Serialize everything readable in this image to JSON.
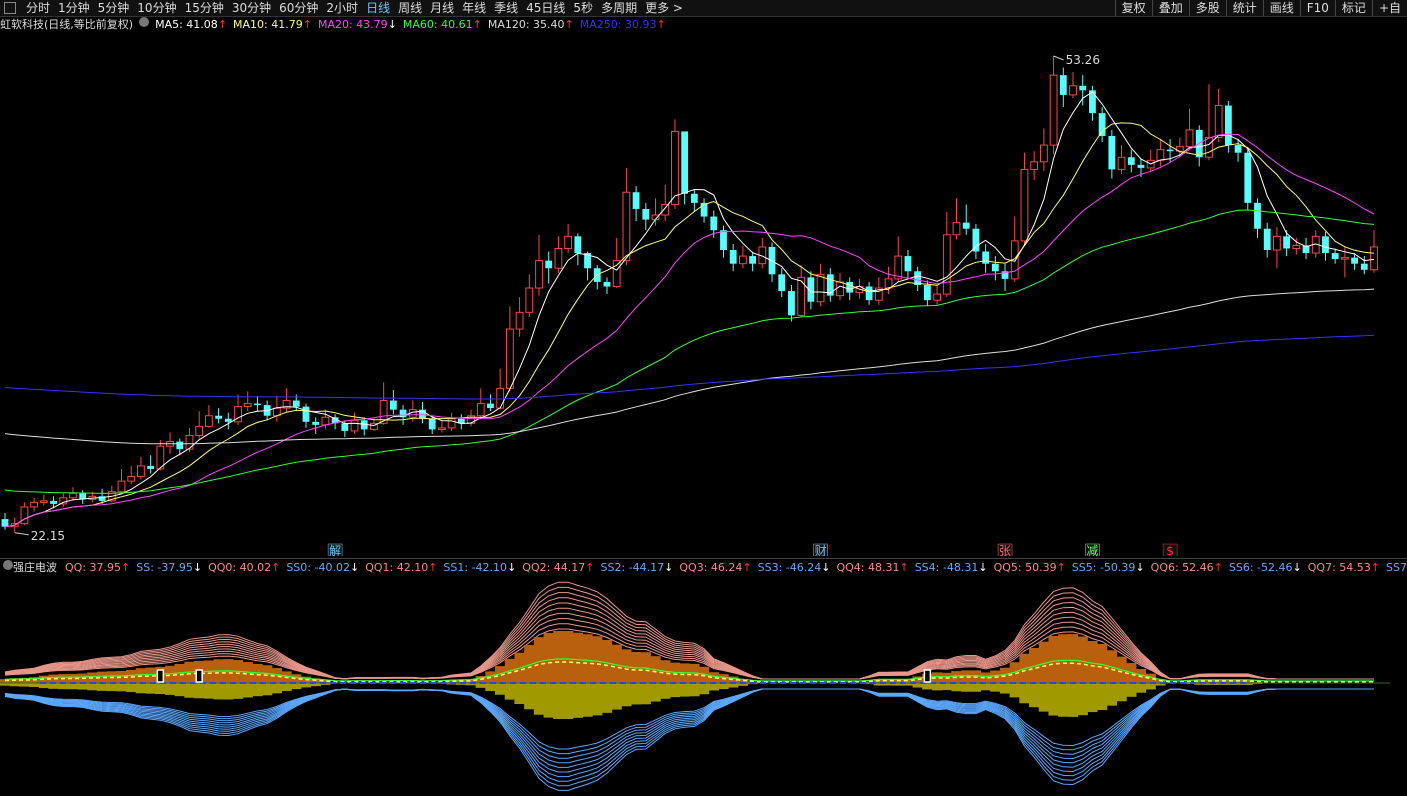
{
  "toolbar": {
    "tabs": [
      "分时",
      "1分钟",
      "5分钟",
      "10分钟",
      "15分钟",
      "30分钟",
      "60分钟",
      "2小时",
      "日线",
      "周线",
      "月线",
      "年线",
      "季线",
      "45日线",
      "5秒",
      "多周期",
      "更多 >"
    ],
    "active_tab": "日线",
    "right_buttons": [
      "复权",
      "叠加",
      "多股",
      "统计",
      "画线",
      "F10",
      "标记",
      "+自"
    ]
  },
  "ma_legend": {
    "stock_name": "虹软科技(日线,等比前复权)",
    "items": [
      {
        "label": "MA5: 41.08",
        "arrow": "↑",
        "color": "#ffffff"
      },
      {
        "label": "MA10: 41.79",
        "arrow": "↑",
        "color": "#ffff66"
      },
      {
        "label": "MA20: 43.79",
        "arrow": "↓",
        "color": "#ff44ff"
      },
      {
        "label": "MA60: 40.61",
        "arrow": "↑",
        "color": "#33ff33"
      },
      {
        "label": "MA120: 35.40",
        "arrow": "↑",
        "color": "#dddddd"
      },
      {
        "label": "MA250: 30.93",
        "arrow": "↑",
        "color": "#3333ff"
      }
    ]
  },
  "indicator_legend": {
    "name": "强庄电波",
    "items": [
      {
        "label": "QQ: 37.95",
        "arrow": "↑",
        "color": "#ff8888"
      },
      {
        "label": "SS: -37.95",
        "arrow": "↓",
        "color": "#66aaff"
      },
      {
        "label": "QQ0: 40.02",
        "arrow": "↑",
        "color": "#ff8888"
      },
      {
        "label": "SS0: -40.02",
        "arrow": "↓",
        "color": "#66aaff"
      },
      {
        "label": "QQ1: 42.10",
        "arrow": "↑",
        "color": "#ff8888"
      },
      {
        "label": "SS1: -42.10",
        "arrow": "↓",
        "color": "#66aaff"
      },
      {
        "label": "QQ2: 44.17",
        "arrow": "↑",
        "color": "#ff8888"
      },
      {
        "label": "SS2: -44.17",
        "arrow": "↓",
        "color": "#66aaff"
      },
      {
        "label": "QQ3: 46.24",
        "arrow": "↑",
        "color": "#ff8888"
      },
      {
        "label": "SS3: -46.24",
        "arrow": "↓",
        "color": "#66aaff"
      },
      {
        "label": "QQ4: 48.31",
        "arrow": "↑",
        "color": "#ff8888"
      },
      {
        "label": "SS4: -48.31",
        "arrow": "↓",
        "color": "#66aaff"
      },
      {
        "label": "QQ5: 50.39",
        "arrow": "↑",
        "color": "#ff8888"
      },
      {
        "label": "SS5: -50.39",
        "arrow": "↓",
        "color": "#66aaff"
      },
      {
        "label": "QQ6: 52.46",
        "arrow": "↑",
        "color": "#ff8888"
      },
      {
        "label": "SS6: -52.46",
        "arrow": "↓",
        "color": "#66aaff"
      },
      {
        "label": "QQ7: 54.53",
        "arrow": "↑",
        "color": "#ff8888"
      },
      {
        "label": "SS7",
        "arrow": "",
        "color": "#66aaff"
      }
    ]
  },
  "chart_data": {
    "type": "candlestick",
    "price_range": [
      22.15,
      53.26
    ],
    "high_label": "53.26",
    "low_label": "22.15",
    "event_markers": [
      {
        "text": "解",
        "color": "#66ccff"
      },
      {
        "text": "财",
        "color": "#66ccff"
      },
      {
        "text": "张",
        "color": "#ff6666"
      },
      {
        "text": "减",
        "color": "#66ff66"
      },
      {
        "text": "$",
        "color": "#ff3333"
      }
    ],
    "candles": [
      [
        22.8,
        22.3,
        23.2,
        22.1
      ],
      [
        22.3,
        22.5,
        22.9,
        21.9
      ],
      [
        22.5,
        23.6,
        23.9,
        22.4
      ],
      [
        23.6,
        23.9,
        24.2,
        23.3
      ],
      [
        23.9,
        24.0,
        24.4,
        23.7
      ],
      [
        24.0,
        23.8,
        24.3,
        23.5
      ],
      [
        23.8,
        24.2,
        24.5,
        23.6
      ],
      [
        24.2,
        24.5,
        24.9,
        24.0
      ],
      [
        24.5,
        24.1,
        24.7,
        23.8
      ],
      [
        24.1,
        24.3,
        24.6,
        23.9
      ],
      [
        24.3,
        24.0,
        24.8,
        23.8
      ],
      [
        24.0,
        24.6,
        25.0,
        23.9
      ],
      [
        24.6,
        25.3,
        26.1,
        24.5
      ],
      [
        25.3,
        25.6,
        26.3,
        25.1
      ],
      [
        25.6,
        26.3,
        26.9,
        25.4
      ],
      [
        26.3,
        26.1,
        27.0,
        25.8
      ],
      [
        26.1,
        27.6,
        28.0,
        26.0
      ],
      [
        27.6,
        27.9,
        28.5,
        27.1
      ],
      [
        27.9,
        27.4,
        28.1,
        27.0
      ],
      [
        27.4,
        28.3,
        28.8,
        27.2
      ],
      [
        28.3,
        28.9,
        29.9,
        28.1
      ],
      [
        28.9,
        29.6,
        30.3,
        28.8
      ],
      [
        29.6,
        29.4,
        30.1,
        29.1
      ],
      [
        29.4,
        29.2,
        29.8,
        28.7
      ],
      [
        29.2,
        30.2,
        31.0,
        29.0
      ],
      [
        30.2,
        30.4,
        31.2,
        29.9
      ],
      [
        30.4,
        30.3,
        30.9,
        29.9
      ],
      [
        30.3,
        29.6,
        30.6,
        29.3
      ],
      [
        29.6,
        30.1,
        30.9,
        29.2
      ],
      [
        30.1,
        30.6,
        31.4,
        29.8
      ],
      [
        30.6,
        30.2,
        31.0,
        29.9
      ],
      [
        30.2,
        29.2,
        30.4,
        28.8
      ],
      [
        29.2,
        29.0,
        29.5,
        28.4
      ],
      [
        29.0,
        29.5,
        30.0,
        28.7
      ],
      [
        29.5,
        29.1,
        29.7,
        28.7
      ],
      [
        29.1,
        28.6,
        29.3,
        28.2
      ],
      [
        28.6,
        29.3,
        29.8,
        28.4
      ],
      [
        29.3,
        28.7,
        29.5,
        28.3
      ],
      [
        28.7,
        29.1,
        29.4,
        28.6
      ],
      [
        29.1,
        30.6,
        31.8,
        29.0
      ],
      [
        30.6,
        30.0,
        31.3,
        29.7
      ],
      [
        30.0,
        29.5,
        30.3,
        29.0
      ],
      [
        29.5,
        30.0,
        30.6,
        29.2
      ],
      [
        30.0,
        29.4,
        30.5,
        29.1
      ],
      [
        29.4,
        28.7,
        29.6,
        28.4
      ],
      [
        28.7,
        28.8,
        29.3,
        28.5
      ],
      [
        28.8,
        29.4,
        29.8,
        28.6
      ],
      [
        29.4,
        29.1,
        29.7,
        28.7
      ],
      [
        29.1,
        29.6,
        30.0,
        28.9
      ],
      [
        29.6,
        30.4,
        31.4,
        29.4
      ],
      [
        30.4,
        30.1,
        31.0,
        29.9
      ],
      [
        30.1,
        31.4,
        32.7,
        30.0
      ],
      [
        31.4,
        35.3,
        36.8,
        31.2
      ],
      [
        35.3,
        36.4,
        37.4,
        34.8
      ],
      [
        36.4,
        38.0,
        38.9,
        36.1
      ],
      [
        38.0,
        39.8,
        41.5,
        37.5
      ],
      [
        39.8,
        39.3,
        40.4,
        38.3
      ],
      [
        39.3,
        40.6,
        41.4,
        39.0
      ],
      [
        40.6,
        41.4,
        42.2,
        40.3
      ],
      [
        41.4,
        40.3,
        41.6,
        39.5
      ],
      [
        40.3,
        39.3,
        40.4,
        38.5
      ],
      [
        39.3,
        38.4,
        39.5,
        37.9
      ],
      [
        38.4,
        38.1,
        38.7,
        37.6
      ],
      [
        38.1,
        39.8,
        41.3,
        38.0
      ],
      [
        39.8,
        44.3,
        45.9,
        39.5
      ],
      [
        44.3,
        43.2,
        44.7,
        42.4
      ],
      [
        43.2,
        42.5,
        43.6,
        41.8
      ],
      [
        42.5,
        42.8,
        43.9,
        42.1
      ],
      [
        42.8,
        43.5,
        44.8,
        42.4
      ],
      [
        43.5,
        48.3,
        49.1,
        43.2
      ],
      [
        48.3,
        44.2,
        45.2,
        43.5
      ],
      [
        44.2,
        43.6,
        44.5,
        43.0
      ],
      [
        43.6,
        42.7,
        43.9,
        42.3
      ],
      [
        42.7,
        41.8,
        43.1,
        41.3
      ],
      [
        41.8,
        40.5,
        42.1,
        40.0
      ],
      [
        40.5,
        39.6,
        40.9,
        39.1
      ],
      [
        39.6,
        40.1,
        40.8,
        39.3
      ],
      [
        40.1,
        39.6,
        40.4,
        39.1
      ],
      [
        39.6,
        40.7,
        41.3,
        39.3
      ],
      [
        40.7,
        38.9,
        41.0,
        38.4
      ],
      [
        38.9,
        37.8,
        39.3,
        37.4
      ],
      [
        37.8,
        36.2,
        38.2,
        35.8
      ],
      [
        36.2,
        38.7,
        39.5,
        36.1
      ],
      [
        38.7,
        37.1,
        39.1,
        36.6
      ],
      [
        37.1,
        38.9,
        39.6,
        36.8
      ],
      [
        38.9,
        37.5,
        39.3,
        37.1
      ],
      [
        37.5,
        38.4,
        39.0,
        37.2
      ],
      [
        38.4,
        37.7,
        38.7,
        37.2
      ],
      [
        37.7,
        38.1,
        38.6,
        37.3
      ],
      [
        38.1,
        37.2,
        38.4,
        36.9
      ],
      [
        37.2,
        38.0,
        38.7,
        36.9
      ],
      [
        38.0,
        38.6,
        39.4,
        37.6
      ],
      [
        38.6,
        40.1,
        41.4,
        38.4
      ],
      [
        40.1,
        39.1,
        40.5,
        38.6
      ],
      [
        39.1,
        38.2,
        39.4,
        37.8
      ],
      [
        38.2,
        37.2,
        38.5,
        36.8
      ],
      [
        37.2,
        37.6,
        38.2,
        36.9
      ],
      [
        37.6,
        41.5,
        43.0,
        37.4
      ],
      [
        41.5,
        42.3,
        43.9,
        41.2
      ],
      [
        42.3,
        41.9,
        43.5,
        41.5
      ],
      [
        41.9,
        40.4,
        42.2,
        39.9
      ],
      [
        40.4,
        39.6,
        40.9,
        39.0
      ],
      [
        39.6,
        39.1,
        40.1,
        38.5
      ],
      [
        39.1,
        38.6,
        39.6,
        37.8
      ],
      [
        38.6,
        41.1,
        42.7,
        38.4
      ],
      [
        41.1,
        45.8,
        46.9,
        40.8
      ],
      [
        45.8,
        46.3,
        47.0,
        45.1
      ],
      [
        46.3,
        47.4,
        48.5,
        45.7
      ],
      [
        47.4,
        52.0,
        53.26,
        46.8
      ],
      [
        52.0,
        50.7,
        52.5,
        49.9
      ],
      [
        50.7,
        51.3,
        52.2,
        50.5
      ],
      [
        51.3,
        51.0,
        52.0,
        50.0
      ],
      [
        51.0,
        49.5,
        51.3,
        49.0
      ],
      [
        49.5,
        48.0,
        49.9,
        47.6
      ],
      [
        48.0,
        45.8,
        48.4,
        45.2
      ],
      [
        45.8,
        46.6,
        47.4,
        45.5
      ],
      [
        46.6,
        46.1,
        47.1,
        45.6
      ],
      [
        46.1,
        45.9,
        46.5,
        45.3
      ],
      [
        45.9,
        46.4,
        47.1,
        45.6
      ],
      [
        46.4,
        47.1,
        47.8,
        46.0
      ],
      [
        47.1,
        47.0,
        47.8,
        46.3
      ],
      [
        47.0,
        47.3,
        47.9,
        46.6
      ],
      [
        47.3,
        48.4,
        49.8,
        47.1
      ],
      [
        48.4,
        46.6,
        48.7,
        46.0
      ],
      [
        46.6,
        47.9,
        51.4,
        46.4
      ],
      [
        47.9,
        50.0,
        51.1,
        47.6
      ],
      [
        50.0,
        47.4,
        50.3,
        46.9
      ],
      [
        47.4,
        46.9,
        47.8,
        46.3
      ],
      [
        46.9,
        43.6,
        47.2,
        43.1
      ],
      [
        43.6,
        41.9,
        43.9,
        41.3
      ],
      [
        41.9,
        40.5,
        42.3,
        40.0
      ],
      [
        40.5,
        41.4,
        42.0,
        39.3
      ],
      [
        41.4,
        40.6,
        41.8,
        40.1
      ],
      [
        40.6,
        40.8,
        41.3,
        40.2
      ],
      [
        40.8,
        40.3,
        41.3,
        39.9
      ],
      [
        40.3,
        41.4,
        41.8,
        40.0
      ],
      [
        41.4,
        40.3,
        41.7,
        39.8
      ],
      [
        40.3,
        39.9,
        40.6,
        39.6
      ],
      [
        39.9,
        40.0,
        40.7,
        38.7
      ],
      [
        40.0,
        39.6,
        40.3,
        39.2
      ],
      [
        39.6,
        39.2,
        40.1,
        38.9
      ],
      [
        39.2,
        40.7,
        41.8,
        39.0
      ]
    ]
  }
}
